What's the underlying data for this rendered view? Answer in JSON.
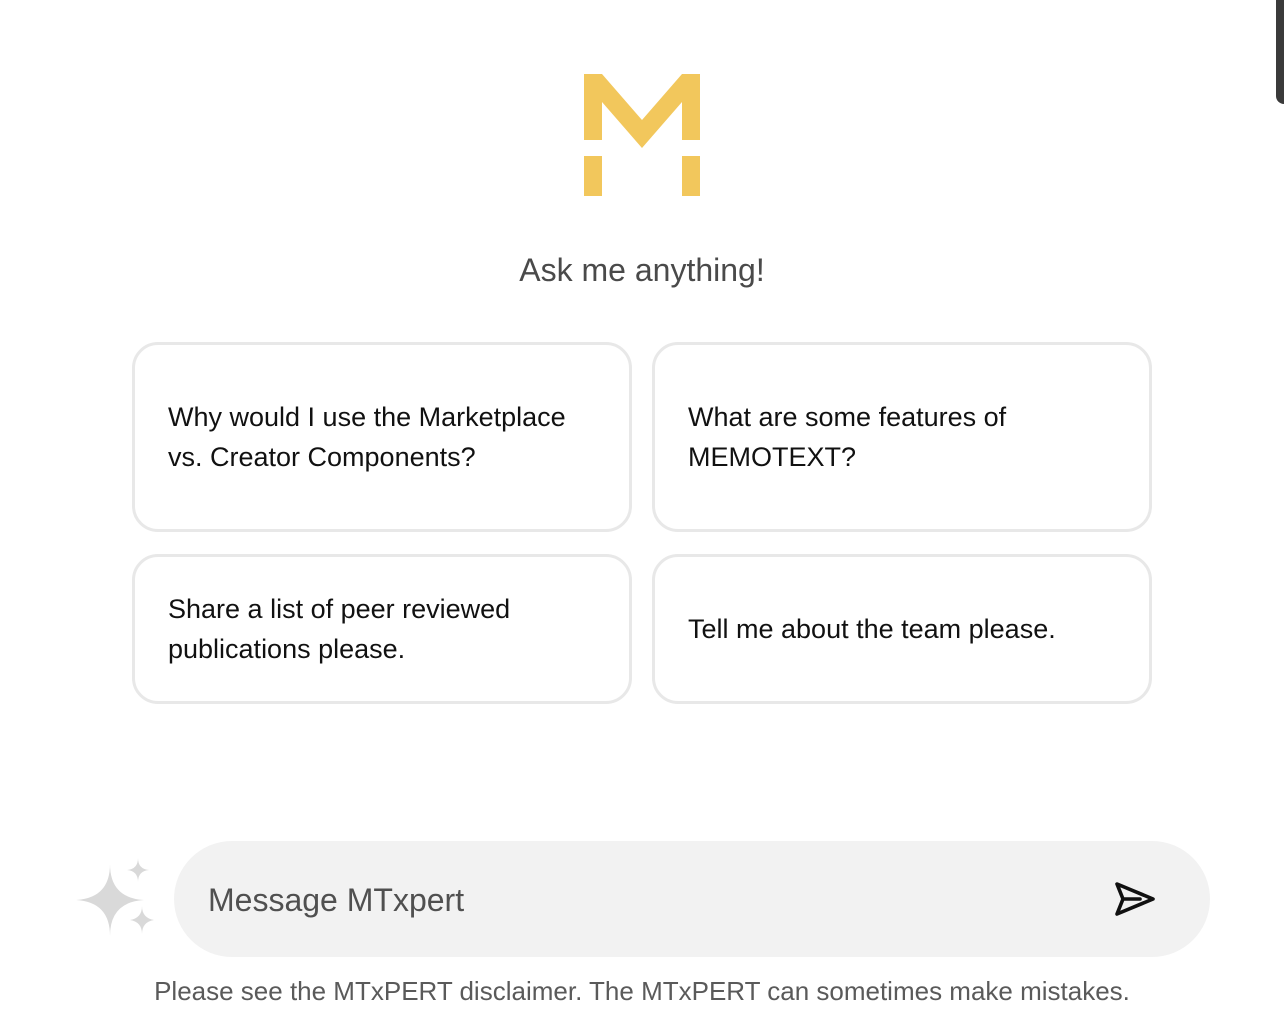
{
  "greeting": "Ask me anything!",
  "suggestions": [
    {
      "label": "Why would I use the Marketplace vs. Creator Components?"
    },
    {
      "label": "What are some features of MEMOTEXT?"
    },
    {
      "label": "Share a list of peer reviewed publications please."
    },
    {
      "label": "Tell me about the team please."
    }
  ],
  "composer": {
    "placeholder": "Message MTxpert",
    "value": "",
    "send_icon": "send-icon",
    "assistant_icon": "sparkle-icon"
  },
  "disclaimer": "Please see the MTxPERT disclaimer. The MTxPERT can sometimes make mistakes.",
  "colors": {
    "brand": "#F2C75C",
    "card_border": "#E8E8E8",
    "composer_bg": "#F2F2F2",
    "sparkle": "#D9D9D9"
  }
}
